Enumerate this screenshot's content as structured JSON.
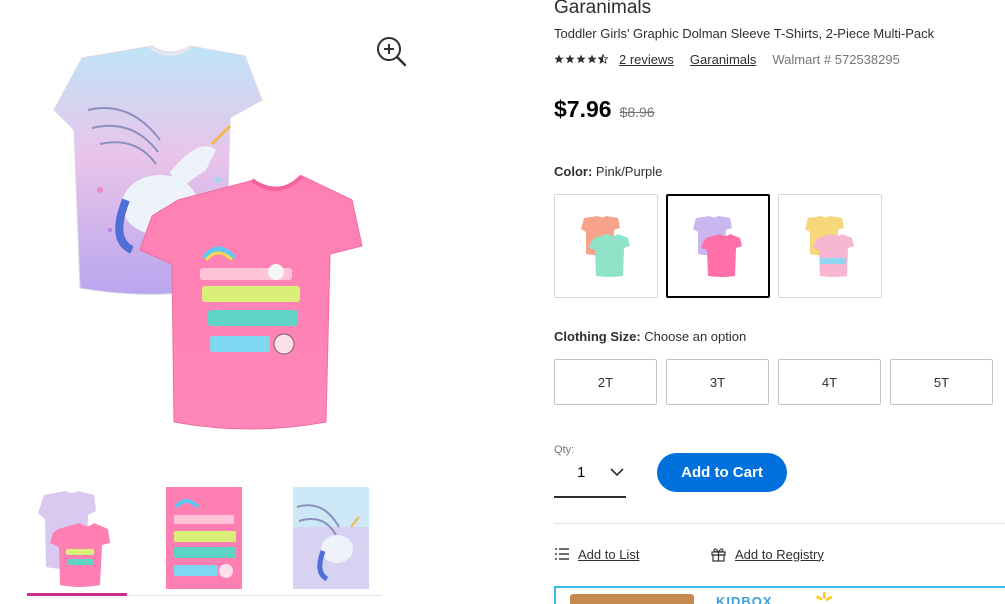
{
  "product": {
    "brand_title": "Garanimals",
    "name": "Toddler Girls' Graphic Dolman Sleeve T-Shirts, 2-Piece Multi-Pack",
    "rating": 4.5,
    "reviews_link": "2 reviews",
    "brand_link": "Garanimals",
    "item_number": "Walmart # 572538295"
  },
  "pricing": {
    "price": "$7.96",
    "was_price": "$8.96"
  },
  "color": {
    "label": "Color:",
    "selected": "Pink/Purple",
    "swatches": [
      {
        "icon": "coral-mint-shirts"
      },
      {
        "icon": "purple-pink-shirts"
      },
      {
        "icon": "yellow-tiedye-shirts"
      }
    ]
  },
  "size": {
    "label": "Clothing Size:",
    "selected": "Choose an option",
    "options": [
      "2T",
      "3T",
      "4T",
      "5T"
    ]
  },
  "quantity": {
    "label": "Qty:",
    "value": "1"
  },
  "actions": {
    "add_to_cart": "Add to Cart",
    "add_to_list": "Add to List",
    "add_to_registry": "Add to Registry"
  },
  "gallery": {
    "main_icon": "product-photo",
    "zoom_icon": "zoom-in-icon",
    "thumbnails": [
      {
        "icon": "two-shirts"
      },
      {
        "icon": "pink-shirt-closeup"
      },
      {
        "icon": "unicorn-shirt-closeup"
      }
    ]
  },
  "promo": {
    "text": "KIDBOX"
  },
  "colors": {
    "accent_blue": "#0071dc",
    "thumb_active": "#c5308f",
    "shirt_pink": "#ff6fa8",
    "shirt_lavender": "#c9b7f0"
  }
}
